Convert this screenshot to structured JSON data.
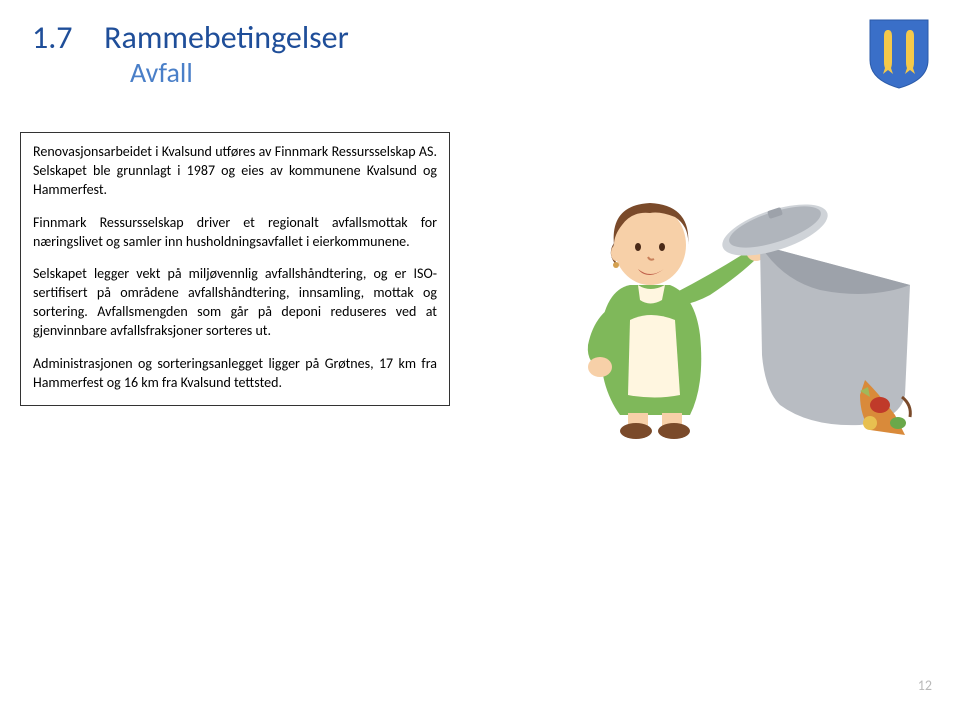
{
  "header": {
    "number": "1.7",
    "title": "Rammebetingelser",
    "subtitle": "Avfall"
  },
  "content": {
    "p1": "Renovasjonsarbeidet i Kvalsund utføres av Finnmark Ressursselskap AS. Selskapet ble grunnlagt i 1987 og eies av kommunene Kvalsund og Hammerfest.",
    "p2": "Finnmark Ressursselskap driver et regionalt avfallsmottak for næringslivet og samler inn husholdningsavfallet i eierkommunene.",
    "p3": "Selskapet legger vekt på miljøvennlig avfallshåndtering, og er ISO-sertifisert på områdene avfallshåndtering, innsamling, mottak og sortering. Avfallsmengden som går på deponi reduseres ved at gjenvinnbare avfallsfraksjoner sorteres ut.",
    "p4": "Administrasjonen og sorteringsanlegget ligger på Grøtnes, 17 km fra Hammerfest og 16 km fra Kvalsund tettsted."
  },
  "page_number": "12",
  "colors": {
    "heading": "#1f4e99",
    "subheading": "#4a7fc8",
    "crest_blue": "#3a6fc8",
    "crest_yellow": "#f5c94a"
  }
}
